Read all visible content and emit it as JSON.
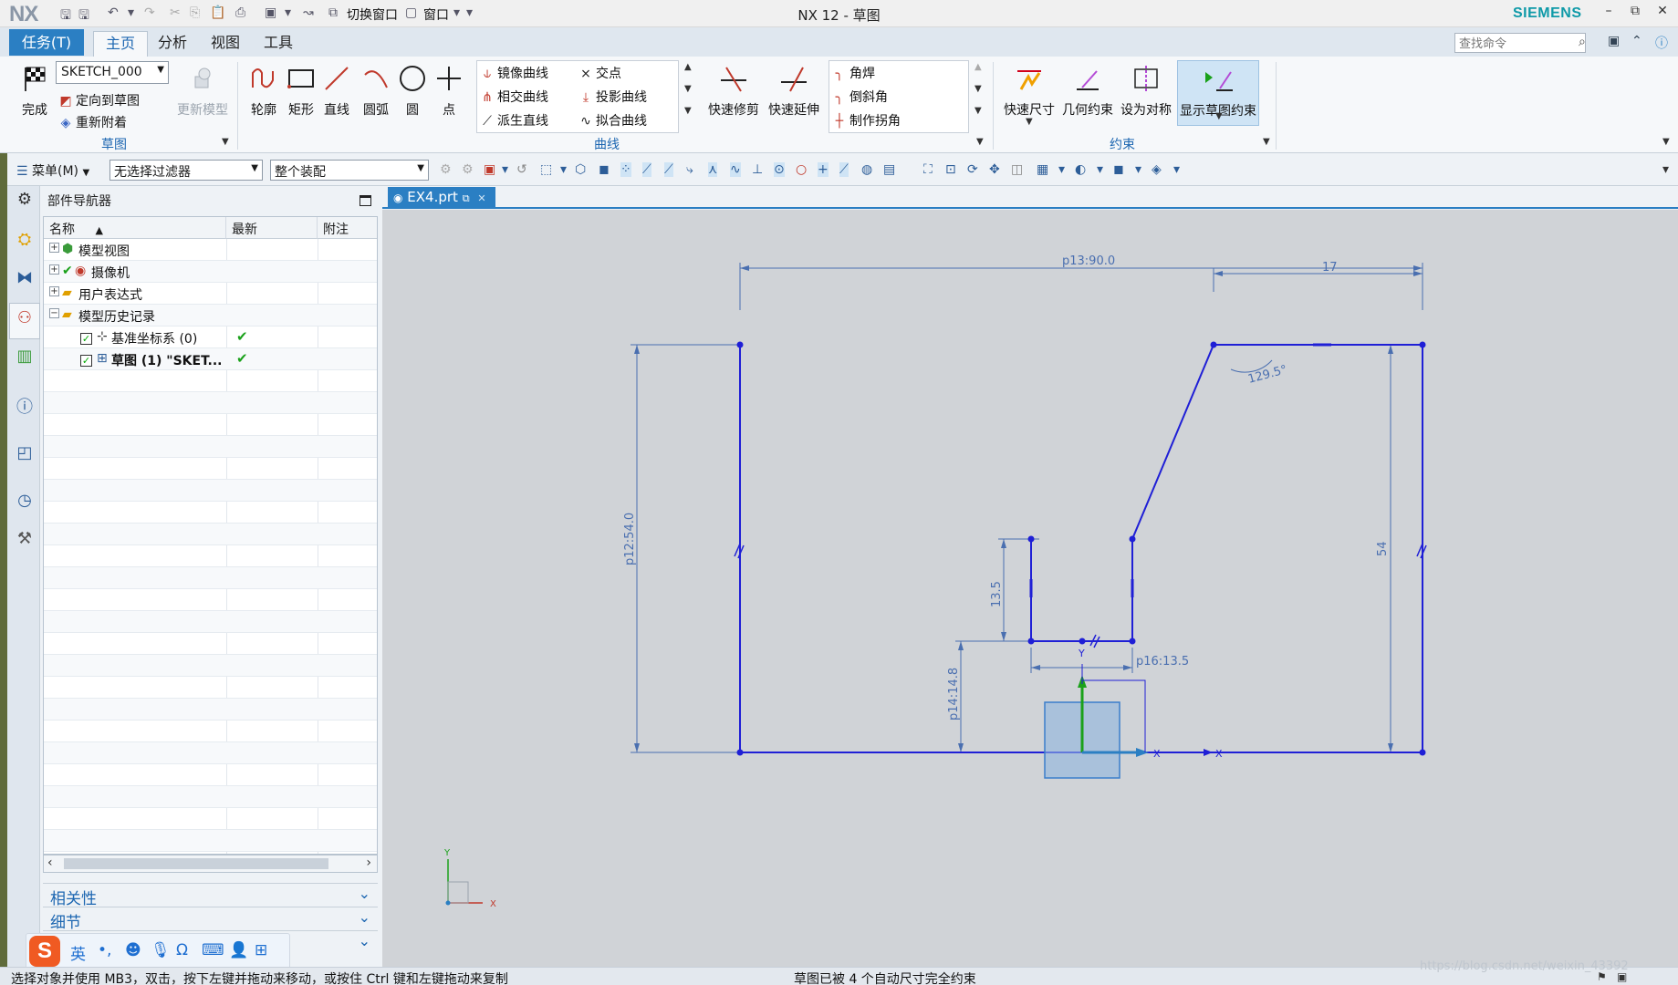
{
  "titlebar": {
    "logo": "NX",
    "switch_window": "切换窗口",
    "window_menu": "窗口",
    "title": "NX 12 - 草图",
    "brand": "SIEMENS",
    "minimize": "–",
    "restore": "⧉",
    "close": "✕"
  },
  "tabs": {
    "task": "任务(T)",
    "items": [
      "主页",
      "分析",
      "视图",
      "工具"
    ],
    "active": "主页"
  },
  "search": {
    "placeholder": "查找命令"
  },
  "ribbon": {
    "sketch_group": {
      "finish": "完成",
      "sketch_name": "SKETCH_000",
      "orient": "定向到草图",
      "reattach": "重新附着",
      "update_model": "更新模型",
      "label": "草图"
    },
    "curve_group": {
      "big": [
        "轮廓",
        "矩形",
        "直线",
        "圆弧",
        "圆",
        "点"
      ],
      "col1": [
        "镜像曲线",
        "相交曲线",
        "派生直线"
      ],
      "col2": [
        "交点",
        "投影曲线",
        "拟合曲线"
      ],
      "trim": "快速修剪",
      "extend": "快速延伸",
      "col3": [
        "角焊",
        "倒斜角",
        "制作拐角"
      ],
      "label": "曲线"
    },
    "constraint_group": {
      "buttons": [
        "快速尺寸",
        "几何约束",
        "设为对称",
        "显示草图约束"
      ],
      "label": "约束"
    }
  },
  "toolbar2": {
    "menu": "菜单(M)",
    "filter": "无选择过滤器",
    "assembly": "整个装配"
  },
  "navigator": {
    "title": "部件导航器",
    "columns": [
      "名称",
      "最新",
      "附注"
    ],
    "nodes": [
      {
        "label": "模型视图",
        "expander": "+"
      },
      {
        "label": "摄像机",
        "expander": "+"
      },
      {
        "label": "用户表达式",
        "expander": "+"
      },
      {
        "label": "模型历史记录",
        "expander": "−"
      },
      {
        "label": "基准坐标系 (0)",
        "check": "✓",
        "latest": "✔"
      },
      {
        "label": "草图 (1) \"SKET...",
        "check": "✓",
        "latest": "✔"
      }
    ],
    "sections": [
      "相关性",
      "细节"
    ]
  },
  "document": {
    "tab": "EX4.prt"
  },
  "sketch": {
    "dims": {
      "top": "p13:90.0",
      "top_right": "17",
      "angle": "129.5°",
      "left": "p12:54.0",
      "right": "54",
      "slot_h": "13.5",
      "slot_w": "p16:13.5",
      "slot_y": "p14:14.8"
    },
    "axis_labels": {
      "y": "Y",
      "x": "X"
    }
  },
  "ime": {
    "logo": "S",
    "lang": "英",
    "punct": "•,"
  },
  "status": {
    "left": "选择对象并使用 MB3，双击，按下左键并拖动来移动，或按住 Ctrl 键和左键拖动来复制",
    "middle": "草图已被 4 个自动尺寸完全约束",
    "watermark": "https://blog.csdn.net/weixin_43392"
  },
  "colors": {
    "accent": "#2b7fc3",
    "sketch_line": "#1f1fd6",
    "dim_line": "#4a6fb0",
    "canvas": "#d0d3d7"
  }
}
